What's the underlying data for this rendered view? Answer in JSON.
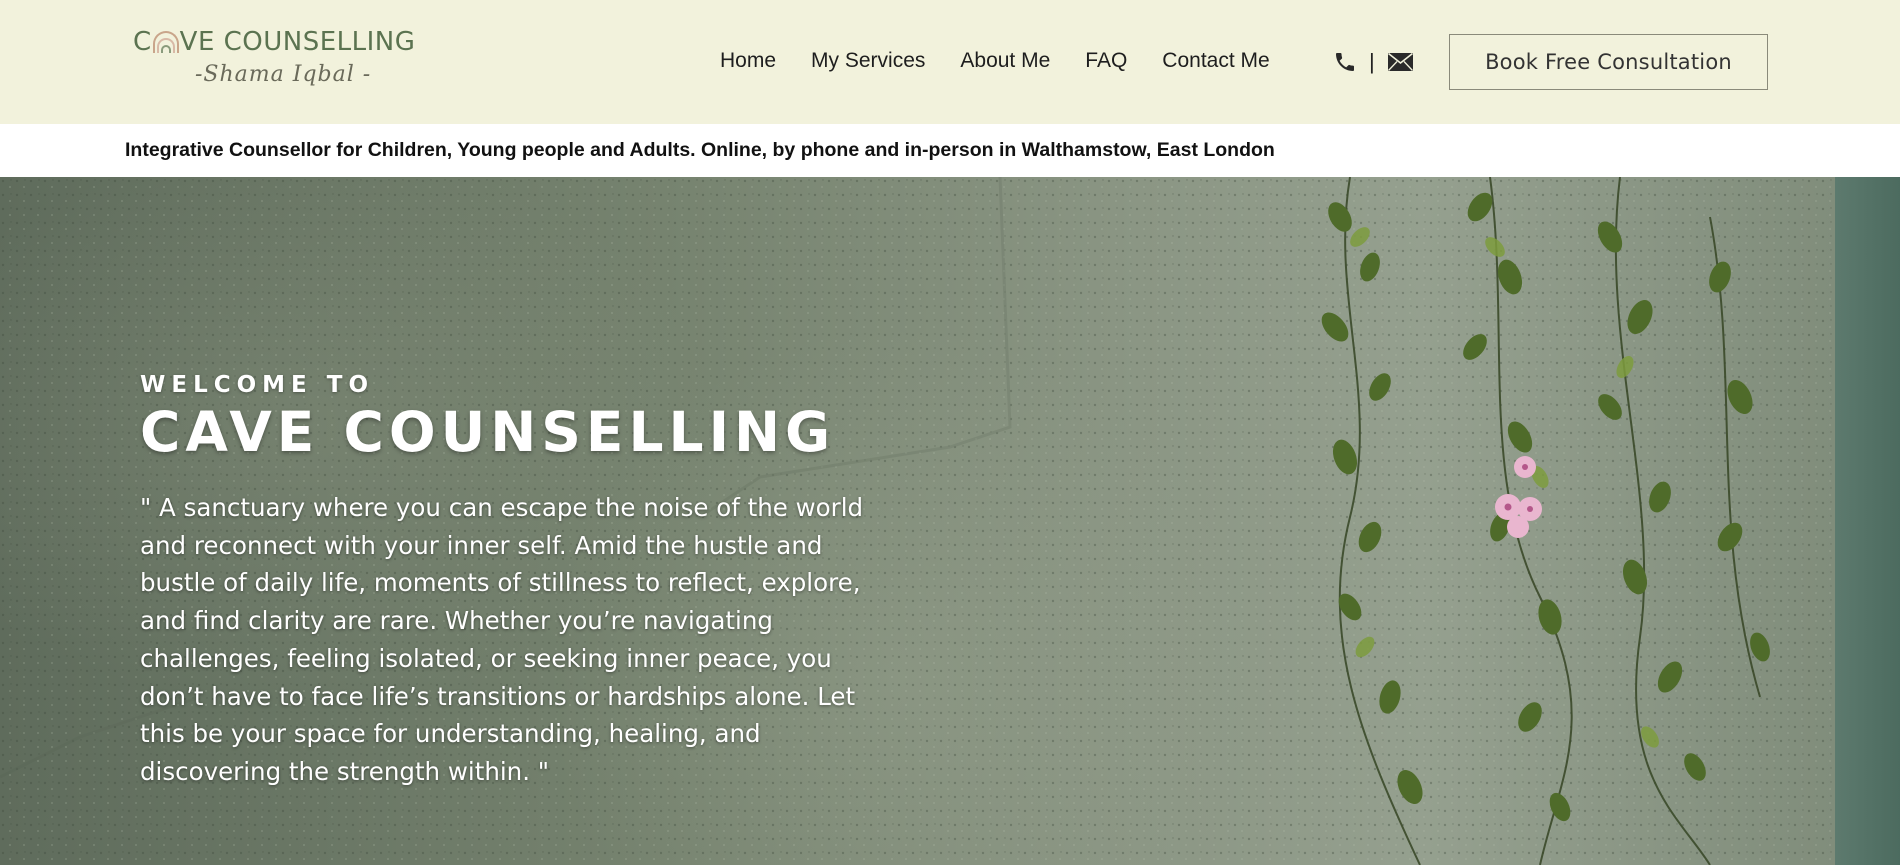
{
  "brand": {
    "logo_title_before": "C",
    "logo_title_after": "VE COUNSELLING",
    "logo_subtitle": "-Shama Iqbal -"
  },
  "nav": {
    "items": [
      {
        "label": "Home"
      },
      {
        "label": "My Services"
      },
      {
        "label": "About Me"
      },
      {
        "label": "FAQ"
      },
      {
        "label": "Contact Me"
      }
    ],
    "separator": "|",
    "phone_icon": "phone-icon",
    "email_icon": "envelope-icon",
    "cta_label": "Book Free Consultation"
  },
  "tagline": "Integrative Counsellor for Children, Young people and Adults. Online, by phone and in-person in Walthamstow, East London",
  "hero": {
    "welcome": "WELCOME TO",
    "title": "CAVE COUNSELLING",
    "quote": "\" A sanctuary where you can escape the noise of the world and reconnect with your inner self. Amid the hustle and bustle of daily life, moments of stillness to reflect, explore, and find clarity are rare. Whether you’re navigating challenges, feeling isolated, or seeking inner peace, you don’t have to face life’s transitions or hardships alone. Let this be your space for understanding, healing, and discovering the strength within. \""
  },
  "colors": {
    "header_bg": "#f2f2dc",
    "logo_green": "#5b7350",
    "arch_outer": "#c9a58a",
    "arch_inner": "#8a9b7c",
    "hero_text": "#ffffff"
  }
}
